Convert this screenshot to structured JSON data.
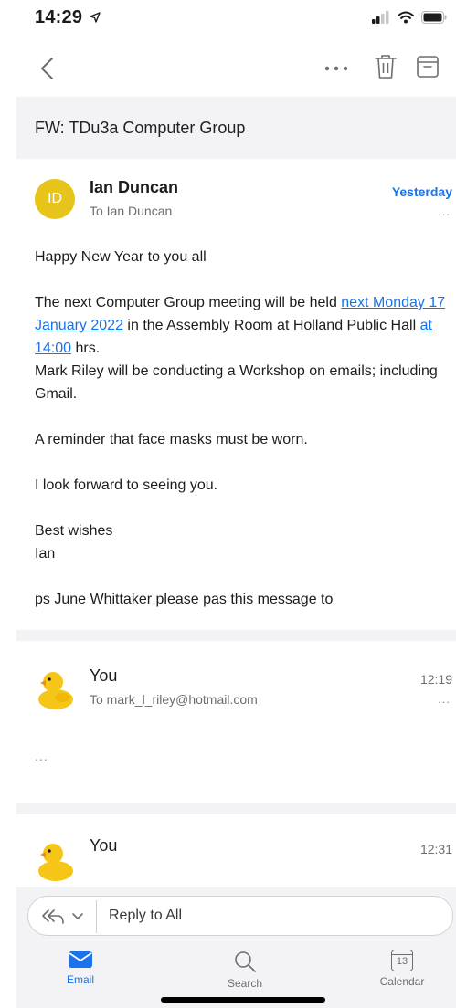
{
  "status": {
    "time": "14:29"
  },
  "toolbar": {
    "more_icon": "ellipsis-icon",
    "delete_icon": "trash-icon",
    "archive_icon": "archive-icon",
    "back_icon": "chevron-left-icon"
  },
  "subject": "FW: TDu3a Computer Group",
  "messages": [
    {
      "avatar_initials": "ID",
      "sender": "Ian Duncan",
      "recipient": "To Ian Duncan",
      "time": "Yesterday",
      "more": "...",
      "body": {
        "greeting": "Happy New Year to you all",
        "p1_a": "The next Computer  Group meeting will be held ",
        "p1_link1": "next Monday 17 January 2022",
        "p1_b": " in the Assembly Room at Holland Public Hall ",
        "p1_link2": "at 14:00",
        "p1_c": " hrs.",
        "p1_d": "Mark Riley will be conducting a Workshop on emails; including Gmail.",
        "p2": "A reminder that face masks must be worn.",
        "p3": "I look forward to seeing you.",
        "signoff1": "Best wishes",
        "signoff2": "Ian",
        "ps": "ps June Whittaker please pas this message to"
      }
    },
    {
      "sender": "You",
      "recipient": "To mark_l_riley@hotmail.com",
      "time": "12:19",
      "more": "...",
      "collapsed": "..."
    },
    {
      "sender": "You",
      "time": "12:31"
    }
  ],
  "reply": {
    "label": "Reply to All",
    "icon": "reply-all-icon"
  },
  "tabs": [
    {
      "label": "Email",
      "icon": "envelope-icon",
      "active": true
    },
    {
      "label": "Search",
      "icon": "search-icon",
      "active": false
    },
    {
      "label": "Calendar",
      "icon": "calendar-icon",
      "date": "13",
      "active": false
    }
  ],
  "colors": {
    "accent": "#1a73e8",
    "avatar": "#e6c419"
  }
}
